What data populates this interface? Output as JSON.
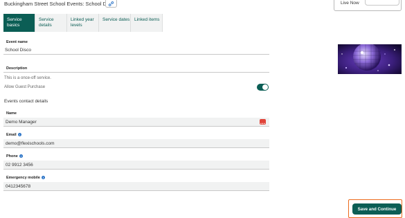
{
  "header": {
    "title": "Buckingham Street School Events: School Disco",
    "live_label": "Live Now"
  },
  "tabs": [
    {
      "label": "Service basics",
      "active": true
    },
    {
      "label": "Service details",
      "active": false
    },
    {
      "label": "Linked year levels",
      "active": false
    },
    {
      "label": "Service dates",
      "active": false
    },
    {
      "label": "Linked items",
      "active": false
    }
  ],
  "form": {
    "event_name_label": "Event name",
    "event_name_value": "School Disco",
    "description_label": "Description",
    "description_value": "This is a once-off service.",
    "guest_purchase_label": "Allow Guest Purchase",
    "guest_purchase_enabled": true
  },
  "contact": {
    "section_title": "Events contact details",
    "name_label": "Name",
    "name_value": "Demo Manager",
    "email_label": "Email",
    "email_value": "demo@flexischools.com",
    "phone_label": "Phone",
    "phone_value": "02 9912 3456",
    "emergency_label": "Emergency mobile",
    "emergency_value": "0412345678"
  },
  "actions": {
    "save_label": "Save and Continue"
  },
  "colors": {
    "primary": "#0b5e55",
    "highlight": "#ec6a1c",
    "info": "#2a73c6",
    "danger": "#e0453a"
  },
  "icons": {
    "link": "link-icon",
    "info": "info-icon",
    "more": "more-dots-icon"
  }
}
